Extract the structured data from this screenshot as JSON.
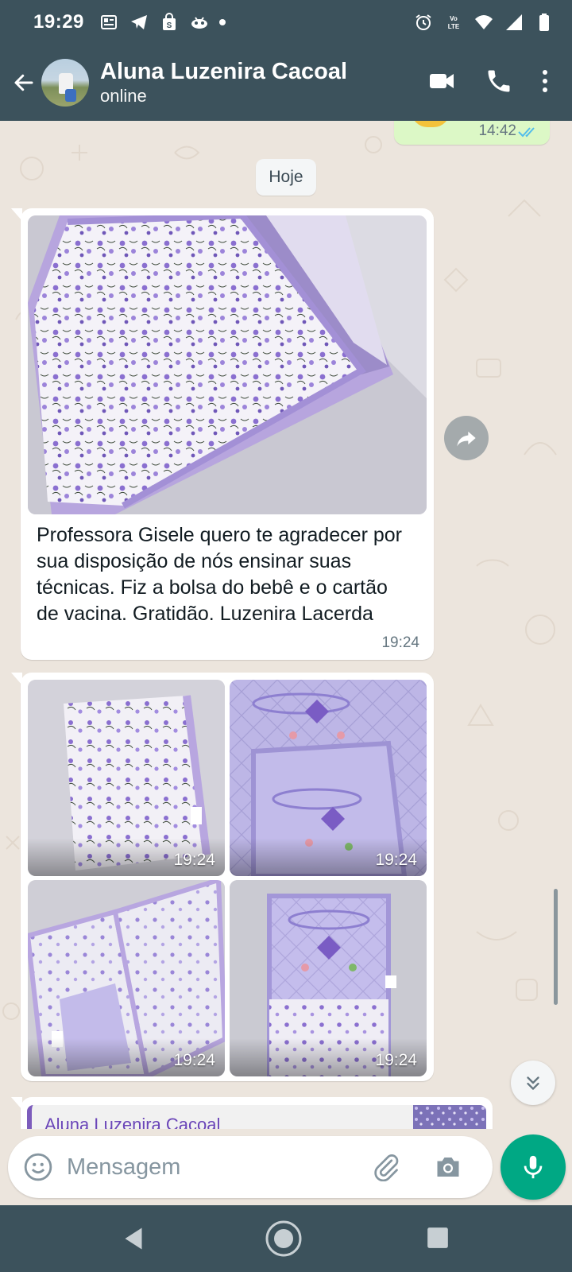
{
  "status_bar": {
    "time": "19:29",
    "left_icons": [
      "news-icon",
      "telegram-icon",
      "shopping-bag-icon",
      "game-controller-icon",
      "dot-icon"
    ],
    "right_icons": [
      "alarm-icon",
      "volte-icon",
      "wifi-icon",
      "signal-icon",
      "battery-icon"
    ]
  },
  "header": {
    "contact_name": "Aluna Luzenira Cacoal",
    "status": "online",
    "actions": [
      "video-call-icon",
      "phone-icon",
      "more-options-icon"
    ]
  },
  "chat": {
    "previous_outgoing": {
      "time": "14:42",
      "read": true
    },
    "date_chip": "Hoje",
    "messages": [
      {
        "type": "image_with_caption",
        "caption": "Professora Gisele quero te agradecer por sua disposição de nós ensinar suas técnicas. Fiz a bolsa do bebê e o cartão de vacina. Gratidão. Luzenira Lacerda",
        "time": "19:24"
      },
      {
        "type": "image_grid",
        "images": [
          {
            "time": "19:24"
          },
          {
            "time": "19:24"
          },
          {
            "time": "19:24"
          },
          {
            "time": "19:24"
          }
        ]
      },
      {
        "type": "reply_preview",
        "quoted_name": "Aluna Luzenira Cacoal"
      }
    ]
  },
  "composer": {
    "placeholder": "Mensagem"
  },
  "colors": {
    "header_bg": "#3c525c",
    "chat_bg": "#ece5dd",
    "outgoing_bubble": "#dcf8c6",
    "mic_button": "#00a884",
    "read_ticks": "#53bdeb",
    "quote_name": "#6b46b8"
  }
}
